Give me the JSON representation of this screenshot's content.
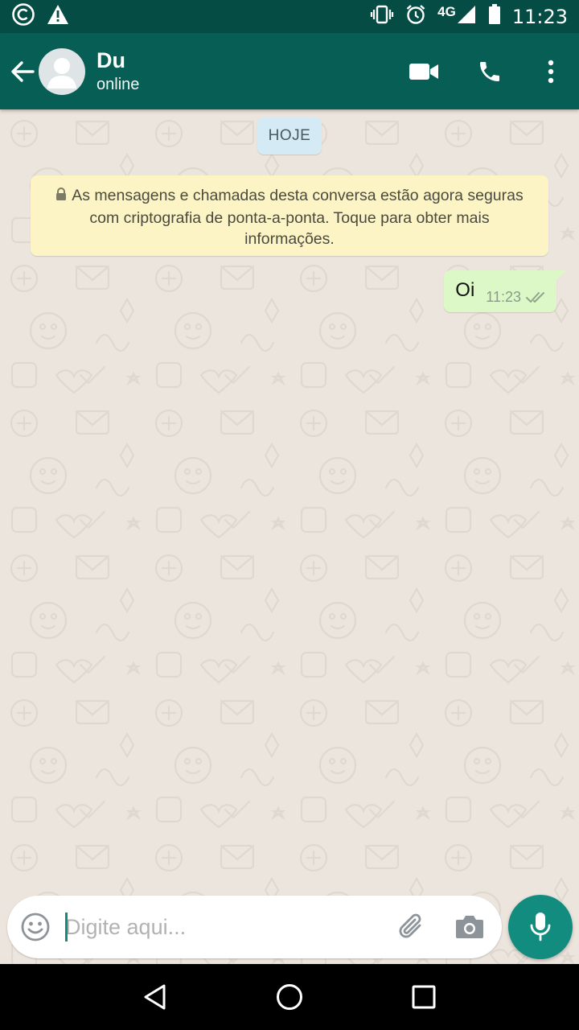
{
  "status_bar": {
    "time": "11:23",
    "network": "4G",
    "left_icons": [
      "copyright-icon",
      "warning-icon"
    ],
    "right_icons": [
      "vibrate-icon",
      "alarm-icon",
      "signal-icon",
      "battery-icon"
    ]
  },
  "header": {
    "contact_name": "Du",
    "contact_status": "online",
    "icons": [
      "back-arrow-icon",
      "avatar",
      "video-call-icon",
      "phone-icon",
      "more-vert-icon"
    ]
  },
  "chat": {
    "date_chip": "HOJE",
    "encryption_notice": "As mensagens e chamadas desta conversa estão agora seguras com criptografia de ponta-a-ponta. Toque para obter mais informações.",
    "messages": [
      {
        "direction": "outgoing",
        "text": "Oi",
        "time": "11:23",
        "status": "delivered"
      }
    ]
  },
  "composer": {
    "placeholder": "Digite aqui...",
    "value": ""
  },
  "colors": {
    "header": "#075e54",
    "status_bar": "#054d44",
    "accent": "#128c7e",
    "outgoing_bubble": "#dcf8c6",
    "notice_bubble": "#fcf4c4",
    "date_chip": "#d4eaf4",
    "chat_bg": "#ece5dd"
  }
}
